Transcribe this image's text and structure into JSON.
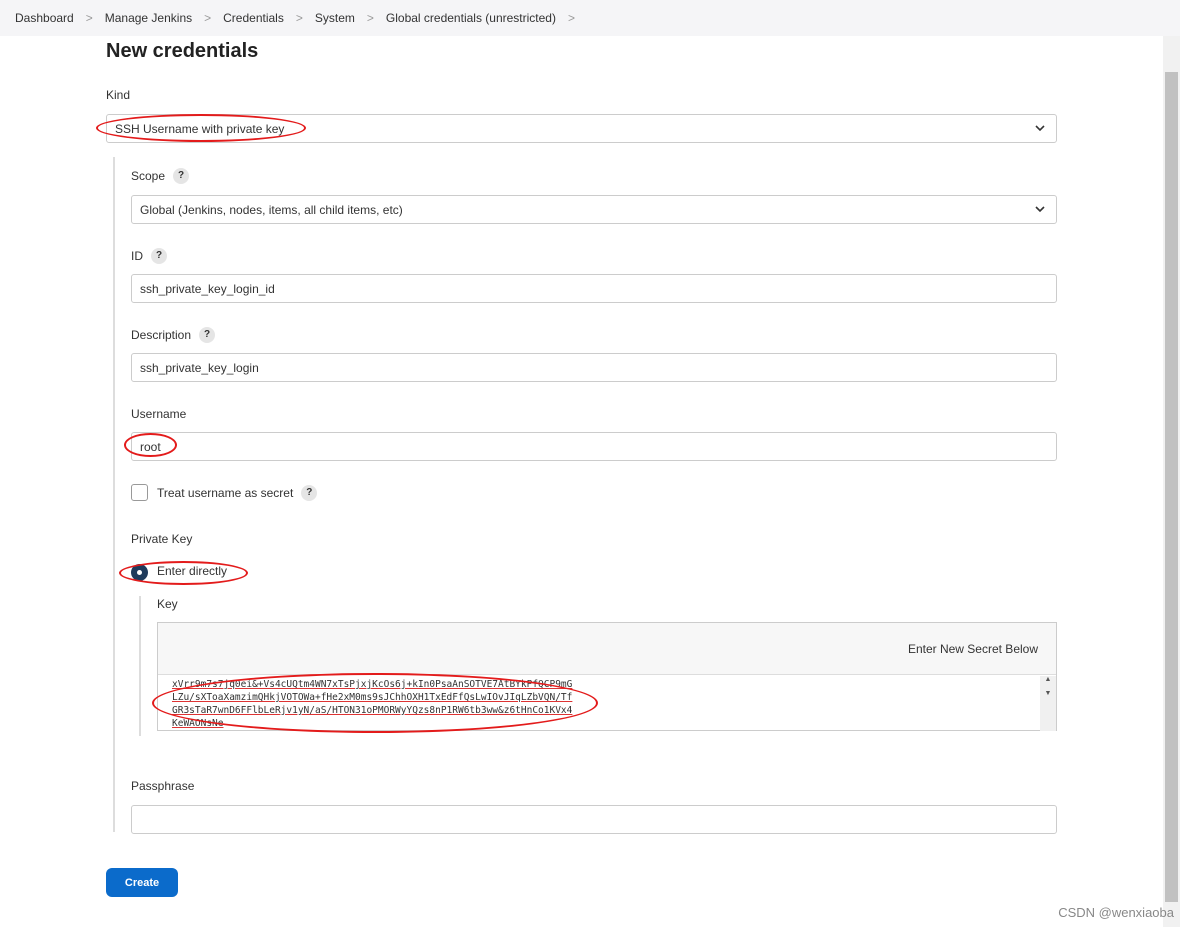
{
  "breadcrumb": [
    "Dashboard",
    "Manage Jenkins",
    "Credentials",
    "System",
    "Global credentials (unrestricted)"
  ],
  "title": "New credentials",
  "kind": {
    "label": "Kind",
    "value": "SSH Username with private key"
  },
  "scope": {
    "label": "Scope",
    "help": "?",
    "value": "Global (Jenkins, nodes, items, all child items, etc)"
  },
  "id": {
    "label": "ID",
    "help": "?",
    "value": "ssh_private_key_login_id"
  },
  "description": {
    "label": "Description",
    "help": "?",
    "value": "ssh_private_key_login"
  },
  "username": {
    "label": "Username",
    "value": "root"
  },
  "treat_secret": {
    "label": "Treat username as secret",
    "help": "?",
    "checked": false
  },
  "private_key": {
    "label": "Private Key",
    "option": "Enter directly",
    "key_label": "Key",
    "secret_hint": "Enter New Secret Below",
    "key_value": "xVrr9m7s7jq0ei&+Vs4cUQtm4WN7xTsPjxjKcOs6j+kIn0PsaAnSOTVE7AtBYkPfQCP9mG\nLZu/sXToaXamzimQHkjVOTOWa+fHe2xM0ms9sJChhOXH1TxEdFfQsLwIOvJIqLZbVQN/Tf\nGR3sTaR7wnD6FFlbLeRjv1yN/aS/HTON31oPMORWyYQzs8nP1RW6tb3ww&z6tHnCo1KVx4\nKeWAONsNe"
  },
  "passphrase": {
    "label": "Passphrase",
    "value": ""
  },
  "create_label": "Create",
  "watermark": "CSDN @wenxiaoba",
  "annotation_color": "#e31b1b"
}
